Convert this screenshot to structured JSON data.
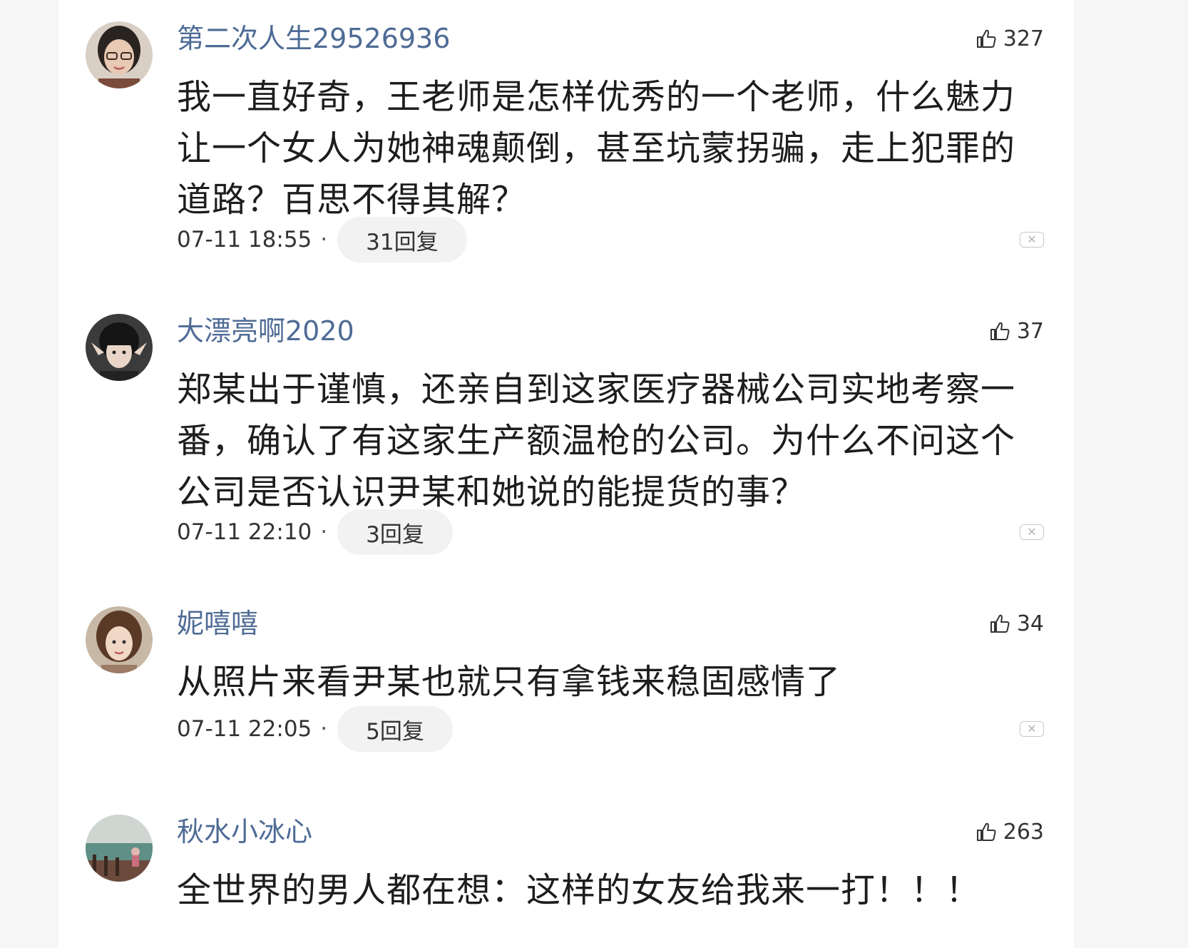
{
  "comments": [
    {
      "username": "第二次人生29526936",
      "likes": "327",
      "text": "我一直好奇，王老师是怎样优秀的一个老师，什么魅力让一个女人为她神魂颠倒，甚至坑蒙拐骗，走上犯罪的道路？百思不得其解？",
      "time": "07-11 18:55",
      "replies": "31回复"
    },
    {
      "username": "大漂亮啊2020",
      "likes": "37",
      "text": "郑某出于谨慎，还亲自到这家医疗器械公司实地考察一番，确认了有这家生产额温枪的公司。为什么不问这个公司是否认识尹某和她说的能提货的事？",
      "time": "07-11 22:10",
      "replies": "3回复"
    },
    {
      "username": "妮嘻嘻",
      "likes": "34",
      "text": "从照片来看尹某也就只有拿钱来稳固感情了",
      "time": "07-11 22:05",
      "replies": "5回复"
    },
    {
      "username": "秋水小冰心",
      "likes": "263",
      "text": "全世界的男人都在想：这样的女友给我来一打！！！"
    }
  ],
  "separator": "·",
  "icons": {
    "like": "thumbs-up-icon",
    "close": "close-icon"
  },
  "colors": {
    "username": "#4e6b95",
    "reply_bg": "#f2f2f2",
    "page_bg": "#f6f6f6"
  }
}
